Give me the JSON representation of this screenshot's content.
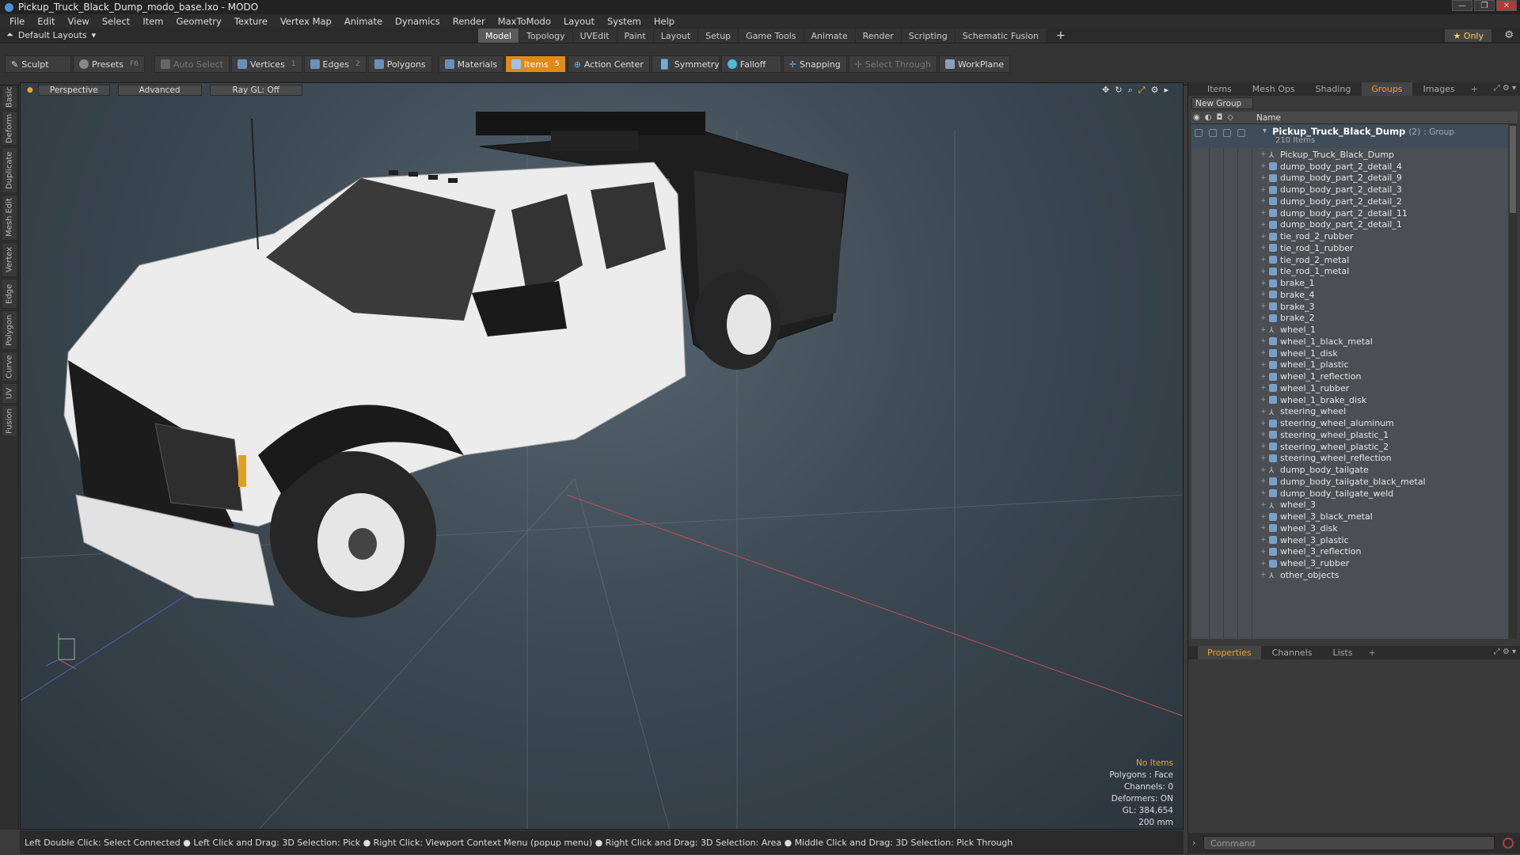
{
  "window": {
    "title": "Pickup_Truck_Black_Dump_modo_base.lxo - MODO",
    "min": "—",
    "max": "❐",
    "close": "✕"
  },
  "menu": [
    "File",
    "Edit",
    "View",
    "Select",
    "Item",
    "Geometry",
    "Texture",
    "Vertex Map",
    "Animate",
    "Dynamics",
    "Render",
    "MaxToModo",
    "Layout",
    "System",
    "Help"
  ],
  "layout": {
    "selector": "Default Layouts",
    "tabs": [
      "Model",
      "Topology",
      "UVEdit",
      "Paint",
      "Layout",
      "Setup",
      "Game Tools",
      "Animate",
      "Render",
      "Scripting",
      "Schematic Fusion"
    ],
    "active_tab": "Model",
    "add": "+",
    "only": "★ Only",
    "gear": "⚙"
  },
  "toolbar": {
    "sculpt": "Sculpt",
    "presets": "Presets",
    "presets_key": "F6",
    "auto_select": "Auto Select",
    "vertices": "Vertices",
    "vertices_key": "1",
    "edges": "Edges",
    "edges_key": "2",
    "polygons": "Polygons",
    "materials": "Materials",
    "items": "Items",
    "items_key": "5",
    "action_center": "Action Center",
    "symmetry": "Symmetry",
    "falloff": "Falloff",
    "snapping": "Snapping",
    "select_through": "Select Through",
    "workplane": "WorkPlane"
  },
  "left_tabs": [
    "Basic",
    "Deform",
    "Duplicate",
    "Mesh Edit",
    "Vertex",
    "Edge",
    "Polygon",
    "Curve",
    "UV",
    "Fusion"
  ],
  "viewport": {
    "view": "Perspective",
    "shading": "Advanced",
    "raygl": "Ray GL: Off",
    "stats": {
      "selection": "No Items",
      "polygons": "Polygons : Face",
      "channels": "Channels: 0",
      "deformers": "Deformers: ON",
      "gl": "GL: 384,654",
      "scale": "200 mm"
    }
  },
  "statusbar": "Left Double Click: Select Connected ● Left Click and Drag: 3D Selection: Pick ● Right Click: Viewport Context Menu (popup menu) ● Right Click and Drag: 3D Selection: Area ● Middle Click and Drag: 3D Selection: Pick Through",
  "panel": {
    "tabs": [
      "Items",
      "Mesh Ops",
      "Shading",
      "Groups",
      "Images"
    ],
    "active_tab": "Groups",
    "new_group": "New Group",
    "column_name": "Name",
    "group": {
      "name": "Pickup_Truck_Black_Dump",
      "count": "(2)",
      "type": ": Group",
      "sub": "210 Items"
    },
    "items": [
      {
        "label": "Pickup_Truck_Black_Dump",
        "icon": "locator"
      },
      {
        "label": "dump_body_part_2_detail_4",
        "icon": "mesh"
      },
      {
        "label": "dump_body_part_2_detail_9",
        "icon": "mesh"
      },
      {
        "label": "dump_body_part_2_detail_3",
        "icon": "mesh"
      },
      {
        "label": "dump_body_part_2_detail_2",
        "icon": "mesh"
      },
      {
        "label": "dump_body_part_2_detail_11",
        "icon": "mesh"
      },
      {
        "label": "dump_body_part_2_detail_1",
        "icon": "mesh"
      },
      {
        "label": "tie_rod_2_rubber",
        "icon": "mesh"
      },
      {
        "label": "tie_rod_1_rubber",
        "icon": "mesh"
      },
      {
        "label": "tie_rod_2_metal",
        "icon": "mesh"
      },
      {
        "label": "tie_rod_1_metal",
        "icon": "mesh"
      },
      {
        "label": "brake_1",
        "icon": "mesh"
      },
      {
        "label": "brake_4",
        "icon": "mesh"
      },
      {
        "label": "brake_3",
        "icon": "mesh"
      },
      {
        "label": "brake_2",
        "icon": "mesh"
      },
      {
        "label": "wheel_1",
        "icon": "locator"
      },
      {
        "label": "wheel_1_black_metal",
        "icon": "mesh"
      },
      {
        "label": "wheel_1_disk",
        "icon": "mesh"
      },
      {
        "label": "wheel_1_plastic",
        "icon": "mesh"
      },
      {
        "label": "wheel_1_reflection",
        "icon": "mesh"
      },
      {
        "label": "wheel_1_rubber",
        "icon": "mesh"
      },
      {
        "label": "wheel_1_brake_disk",
        "icon": "mesh"
      },
      {
        "label": "steering_wheel",
        "icon": "locator"
      },
      {
        "label": "steering_wheel_aluminum",
        "icon": "mesh"
      },
      {
        "label": "steering_wheel_plastic_1",
        "icon": "mesh"
      },
      {
        "label": "steering_wheel_plastic_2",
        "icon": "mesh"
      },
      {
        "label": "steering_wheel_reflection",
        "icon": "mesh"
      },
      {
        "label": "dump_body_tailgate",
        "icon": "locator"
      },
      {
        "label": "dump_body_tailgate_black_metal",
        "icon": "mesh"
      },
      {
        "label": "dump_body_tailgate_weld",
        "icon": "mesh"
      },
      {
        "label": "wheel_3",
        "icon": "locator"
      },
      {
        "label": "wheel_3_black_metal",
        "icon": "mesh"
      },
      {
        "label": "wheel_3_disk",
        "icon": "mesh"
      },
      {
        "label": "wheel_3_plastic",
        "icon": "mesh"
      },
      {
        "label": "wheel_3_reflection",
        "icon": "mesh"
      },
      {
        "label": "wheel_3_rubber",
        "icon": "mesh"
      },
      {
        "label": "other_objects",
        "icon": "locator"
      }
    ],
    "prop_tabs": [
      "Properties",
      "Channels",
      "Lists"
    ],
    "prop_active": "Properties",
    "command_placeholder": "Command"
  },
  "colors": {
    "accent": "#f0a030",
    "active_tool": "#e08a1a",
    "selection_row": "#3f4d5a"
  }
}
